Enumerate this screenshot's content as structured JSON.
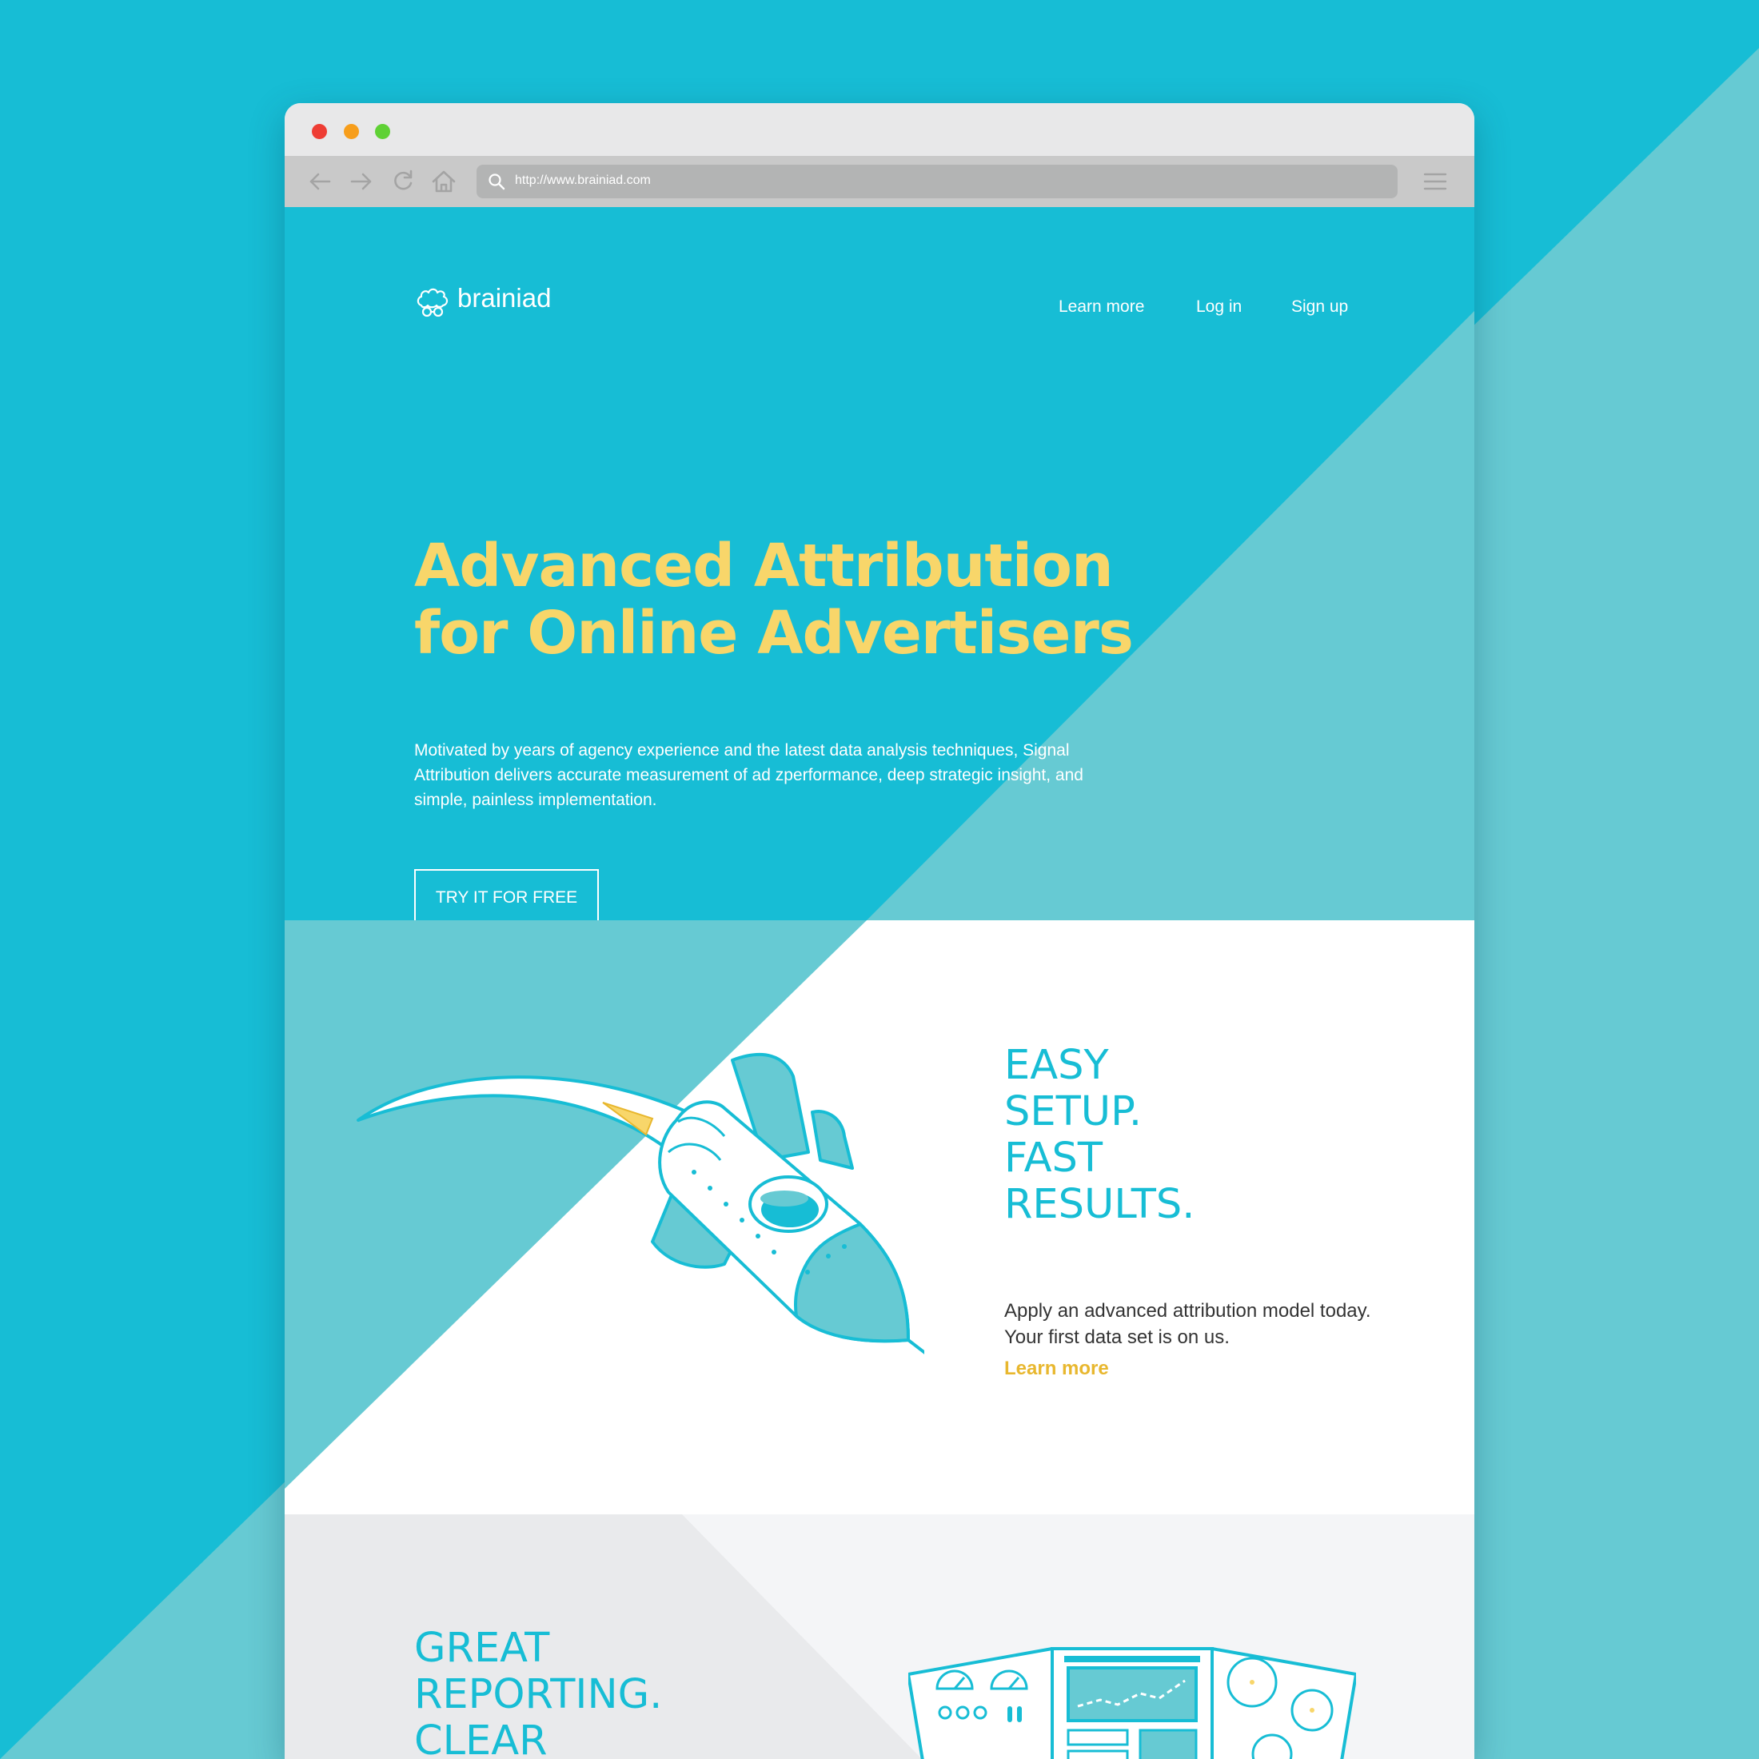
{
  "browser": {
    "url": "http://www.brainiad.com"
  },
  "site": {
    "logo_text": "brainiad",
    "nav": [
      "Learn more",
      "Log in",
      "Sign up"
    ]
  },
  "hero": {
    "title_lines": [
      "Advanced Attribution",
      "for Online Advertisers"
    ],
    "description": "Motivated by years of agency experience and the latest data analysis techniques, Signal Attribution delivers accurate measurement of ad zperformance, deep strategic insight, and simple, painless implementation.",
    "cta_label": "TRY IT FOR FREE"
  },
  "feature": {
    "heading_lines": [
      "EASY",
      "SETUP.",
      "FAST",
      "RESULTS."
    ],
    "description": "Apply an advanced attribution model today. Your first data set is on us.",
    "link_label": "Learn more"
  },
  "reporting": {
    "heading_lines": [
      "GREAT",
      "REPORTING.",
      "CLEAR"
    ]
  },
  "colors": {
    "primary_teal": "#17bdd5",
    "light_teal": "#66cad3",
    "headline_yellow": "#f8d66a",
    "link_gold": "#e8b72e"
  }
}
